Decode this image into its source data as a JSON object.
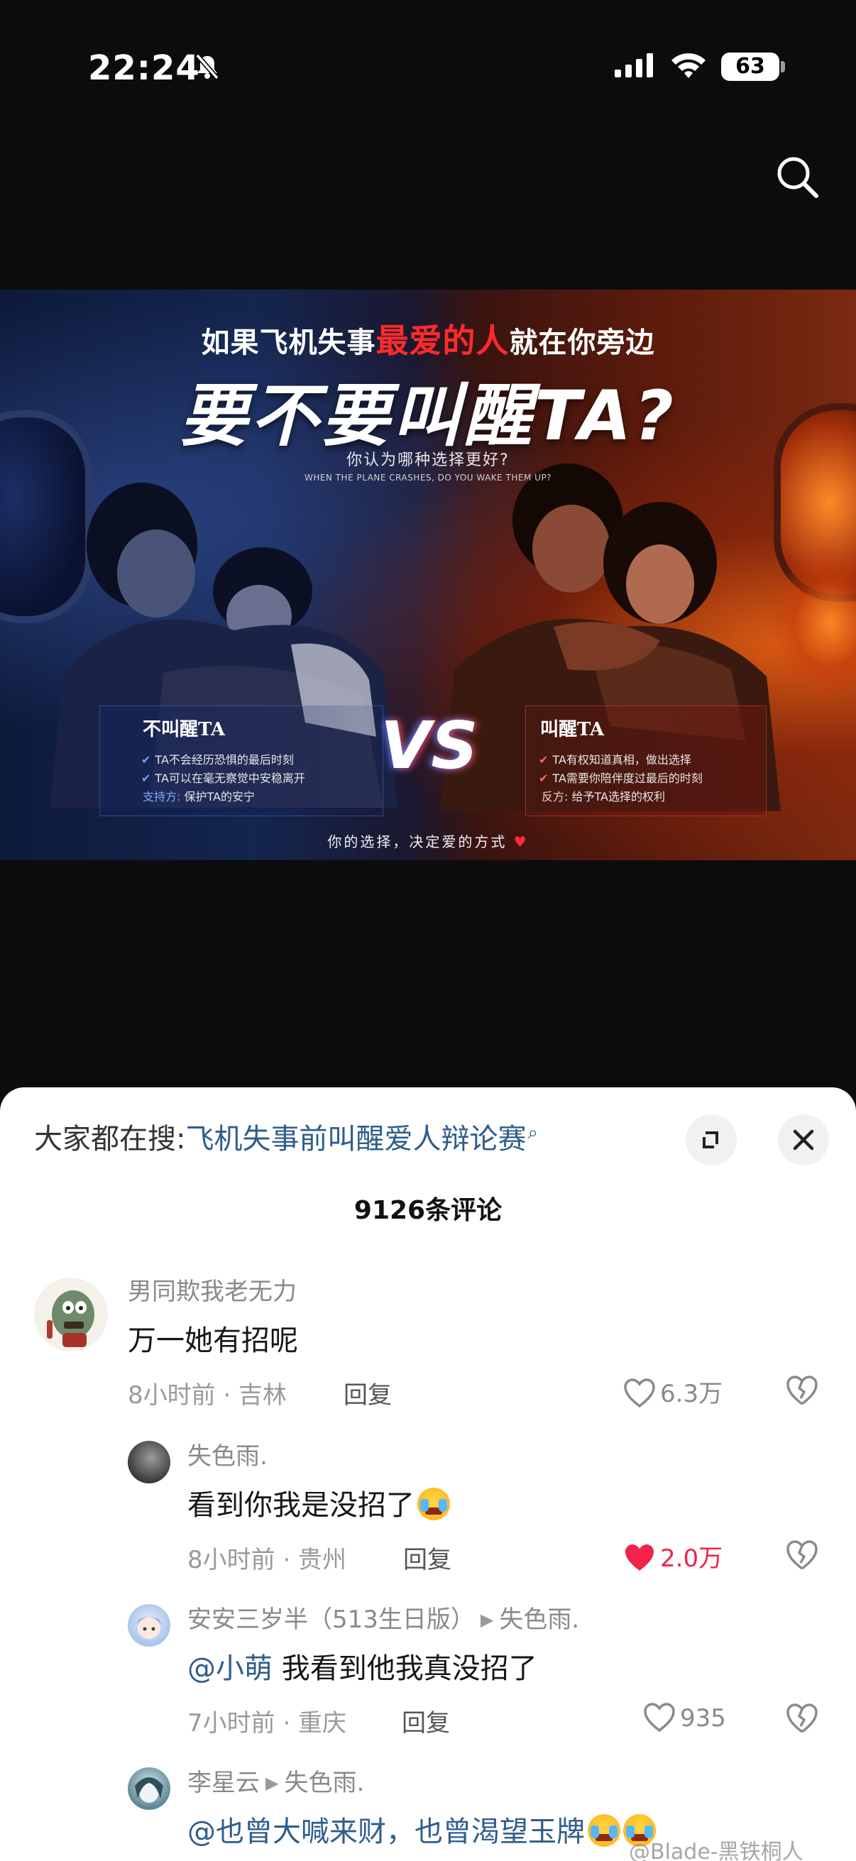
{
  "status_bar": {
    "time": "22:24",
    "battery": "63"
  },
  "poster": {
    "headline_part1": "如果飞机失事",
    "headline_highlight": "最爱的人",
    "headline_part2": "就在你旁边",
    "main_title": "要不要叫醒TA?",
    "subtitle_cn": "你认为哪种选择更好?",
    "subtitle_en": "WHEN THE PLANE CRASHES, DO YOU WAKE THEM UP?",
    "vs": "VS",
    "left": {
      "title": "不叫醒TA",
      "items": [
        "TA不会经历恐惧的最后时刻",
        "TA可以在毫无察觉中安稳离开"
      ],
      "side_label": "支持方:",
      "side_text": "保护TA的安宁"
    },
    "right": {
      "title": "叫醒TA",
      "items": [
        "TA有权知道真相，做出选择",
        "TA需要你陪伴度过最后的时刻"
      ],
      "side_label": "反方:",
      "side_text": "给予TA选择的权利"
    },
    "footer": "你的选择，决定爱的方式",
    "footer_heart": "♥"
  },
  "sheet": {
    "trending_label": "大家都在搜:",
    "trending_query": "飞机失事前叫醒爱人辩论赛",
    "comment_count": "9126条评论"
  },
  "comments": [
    {
      "author": "男同欺我老无力",
      "text": "万一她有招呢",
      "meta": "8小时前 · 吉林",
      "reply": "回复",
      "likes": "6.3万"
    },
    {
      "author": "失色雨.",
      "text": "看到你我是没招了",
      "meta": "8小时前 · 贵州",
      "reply": "回复",
      "likes": "2.0万"
    },
    {
      "author": "安安三岁半（513生日版）",
      "reply_to": "失色雨.",
      "mention": "@小萌",
      "text": " 我看到他我真没招了",
      "meta": "7小时前 · 重庆",
      "reply": "回复",
      "likes": "935"
    },
    {
      "author": "李星云",
      "reply_to": "失色雨.",
      "mention": "@也曾大喊来财，也曾渴望玉牌"
    }
  ],
  "watermark": "@Blade-黑铁桐人",
  "colors": {
    "accent_blue": "#2f5d8c",
    "like_red": "#f2224b"
  }
}
